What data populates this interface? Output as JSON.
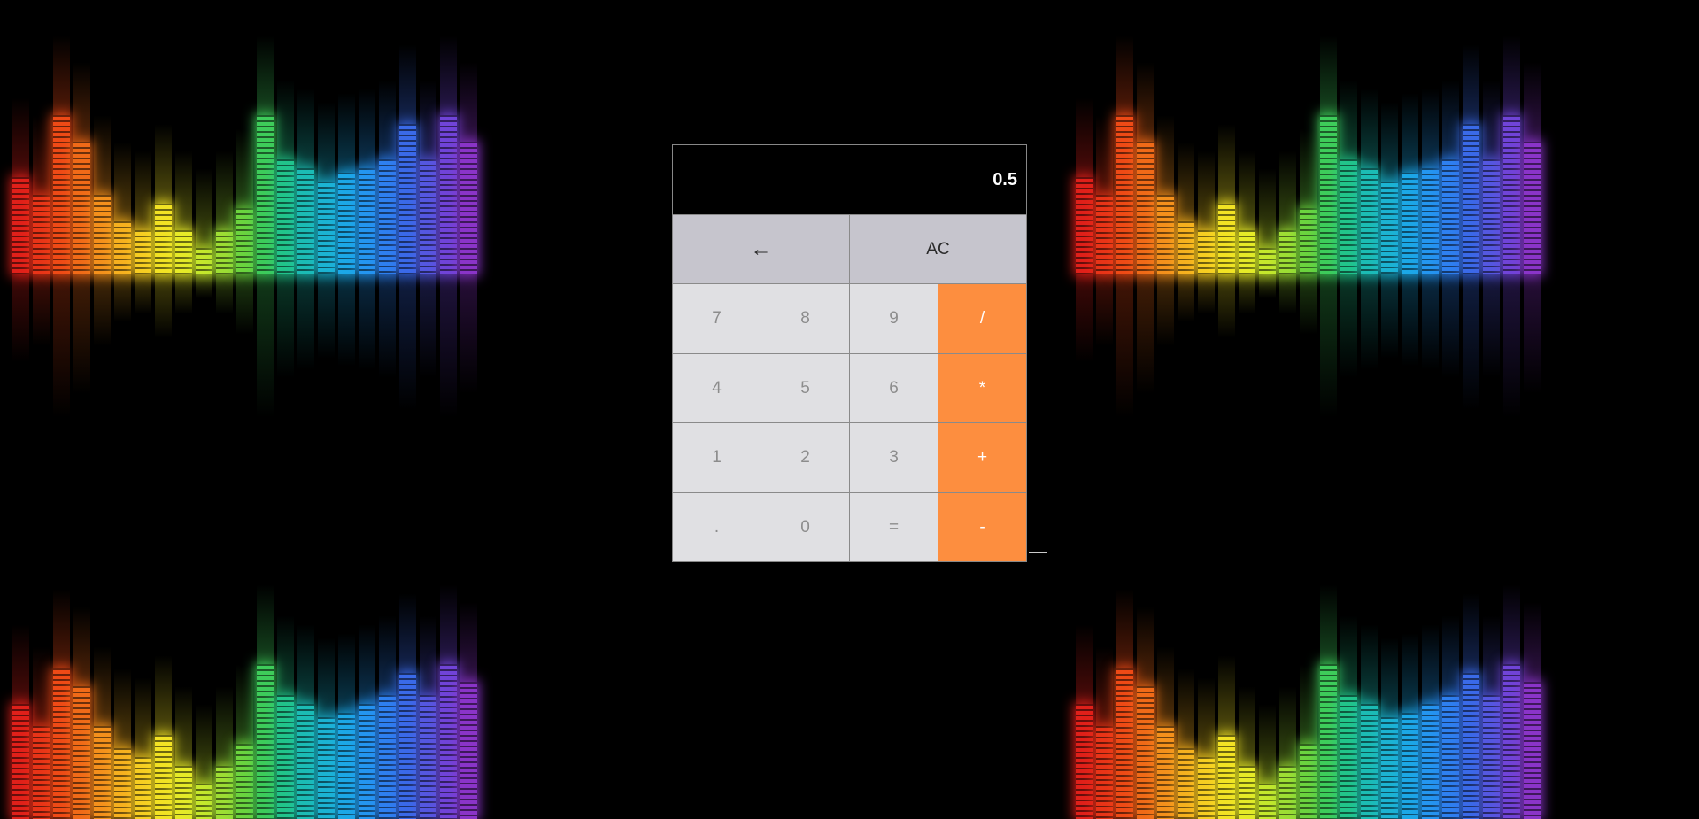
{
  "display": {
    "value": "0.5"
  },
  "keys": {
    "backspace": "←",
    "clear": "AC",
    "seven": "7",
    "eight": "8",
    "nine": "9",
    "divide": "/",
    "four": "4",
    "five": "5",
    "six": "6",
    "multiply": "*",
    "one": "1",
    "two": "2",
    "three": "3",
    "add": "+",
    "decimal": ".",
    "zero": "0",
    "equals": "=",
    "subtract": "-"
  },
  "colors": {
    "background": "#000000",
    "display_bg": "#000000",
    "digit_key_bg": "#e0e0e3",
    "top_key_bg": "#c6c5cd",
    "operator_key_bg": "#fd8e3f"
  },
  "background_image": {
    "description_icon": "audio-equalizer-bars"
  }
}
